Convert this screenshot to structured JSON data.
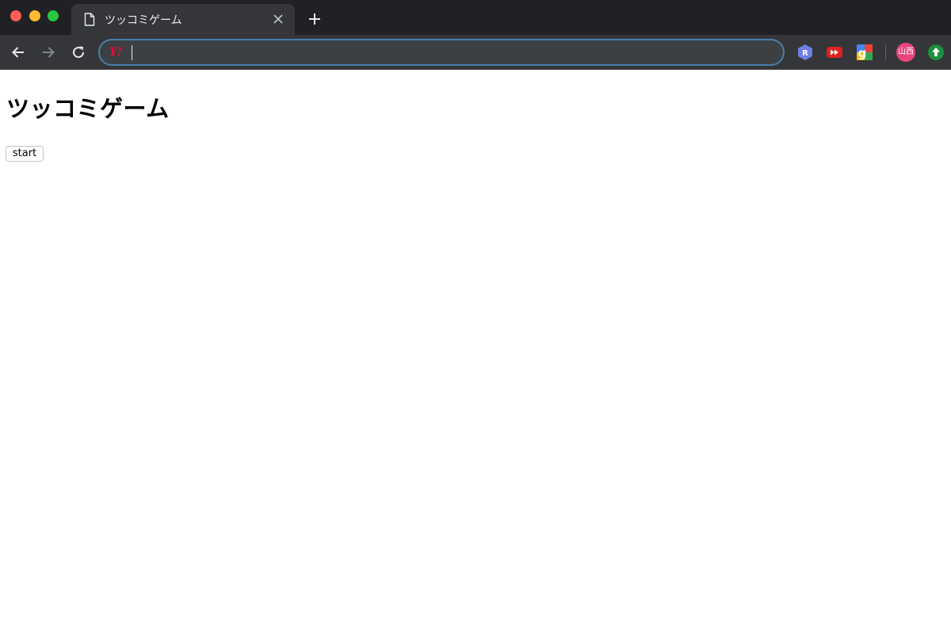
{
  "window": {
    "tab_title": "ツッコミゲーム",
    "new_tab_glyph": "+",
    "colors": {
      "titlebar": "#202124",
      "toolbar": "#35363a",
      "omnibox_border": "#4a7eab"
    }
  },
  "toolbar": {
    "address_value": "",
    "search_engine_icon": "Y!",
    "extensions": [
      "r-extension-icon",
      "play-extension-icon",
      "google-extension-icon",
      "upload-extension-icon"
    ],
    "profile_avatar": "山西",
    "avatar_color": "#e8457c"
  },
  "page": {
    "heading": "ツッコミゲーム",
    "start_button": "start"
  }
}
